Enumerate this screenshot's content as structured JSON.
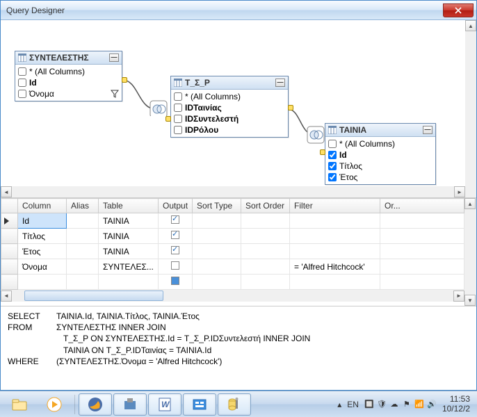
{
  "window": {
    "title": "Query Designer"
  },
  "tables": {
    "t1": {
      "name": "ΣΥΝΤΕΛΕΣΤΗΣ",
      "cols": [
        {
          "label": "* (All Columns)",
          "bold": false,
          "checked": false
        },
        {
          "label": "Id",
          "bold": true,
          "checked": false
        },
        {
          "label": "Όνομα",
          "bold": false,
          "checked": false,
          "filter": true
        }
      ]
    },
    "t2": {
      "name": "Τ_Σ_Ρ",
      "cols": [
        {
          "label": "* (All Columns)",
          "bold": false,
          "checked": false
        },
        {
          "label": "IDΤαινίας",
          "bold": true,
          "checked": false
        },
        {
          "label": "IDΣυντελεστή",
          "bold": true,
          "checked": false
        },
        {
          "label": "IDΡόλου",
          "bold": true,
          "checked": false
        }
      ]
    },
    "t3": {
      "name": "ΤΑΙΝΙΑ",
      "cols": [
        {
          "label": "* (All Columns)",
          "bold": false,
          "checked": false
        },
        {
          "label": "Id",
          "bold": true,
          "checked": true
        },
        {
          "label": "Τίτλος",
          "bold": false,
          "checked": true
        },
        {
          "label": "Έτος",
          "bold": false,
          "checked": true
        }
      ]
    }
  },
  "grid": {
    "headers": {
      "column": "Column",
      "alias": "Alias",
      "table": "Table",
      "output": "Output",
      "sortType": "Sort Type",
      "sortOrder": "Sort Order",
      "filter": "Filter",
      "or": "Or..."
    },
    "rows": [
      {
        "column": "Id",
        "alias": "",
        "table": "ΤΑΙΝΙΑ",
        "output": true,
        "sortType": "",
        "sortOrder": "",
        "filter": "",
        "selected": true,
        "pointer": true
      },
      {
        "column": "Τίτλος",
        "alias": "",
        "table": "ΤΑΙΝΙΑ",
        "output": true,
        "sortType": "",
        "sortOrder": "",
        "filter": ""
      },
      {
        "column": "Έτος",
        "alias": "",
        "table": "ΤΑΙΝΙΑ",
        "output": true,
        "sortType": "",
        "sortOrder": "",
        "filter": ""
      },
      {
        "column": "Όνομα",
        "alias": "",
        "table": "ΣΥΝΤΕΛΕΣ...",
        "output": false,
        "sortType": "",
        "sortOrder": "",
        "filter": "= 'Alfred Hitchcock'"
      },
      {
        "column": "",
        "alias": "",
        "table": "",
        "output": "active",
        "sortType": "",
        "sortOrder": "",
        "filter": ""
      }
    ]
  },
  "sql": {
    "select": "SELECT",
    "selectBody": "ΤΑΙΝΙΑ.Id, ΤΑΙΝΙΑ.Τίτλος, ΤΑΙΝΙΑ.Έτος",
    "from": "FROM",
    "fromBody1": "ΣΥΝΤΕΛΕΣΤΗΣ INNER JOIN",
    "fromBody2": "Τ_Σ_Ρ ON ΣΥΝΤΕΛΕΣΤΗΣ.Id = Τ_Σ_Ρ.IDΣυντελεστή INNER JOIN",
    "fromBody3": "ΤΑΙΝΙΑ ON Τ_Σ_Ρ.IDΤαινίας = ΤΑΙΝΙΑ.Id",
    "where": "WHERE",
    "whereBody": "(ΣΥΝΤΕΛΕΣΤΗΣ.Όνομα = 'Alfred Hitchcock')"
  },
  "taskbar": {
    "lang": "EN",
    "time": "11:53",
    "date": "10/12/2"
  }
}
